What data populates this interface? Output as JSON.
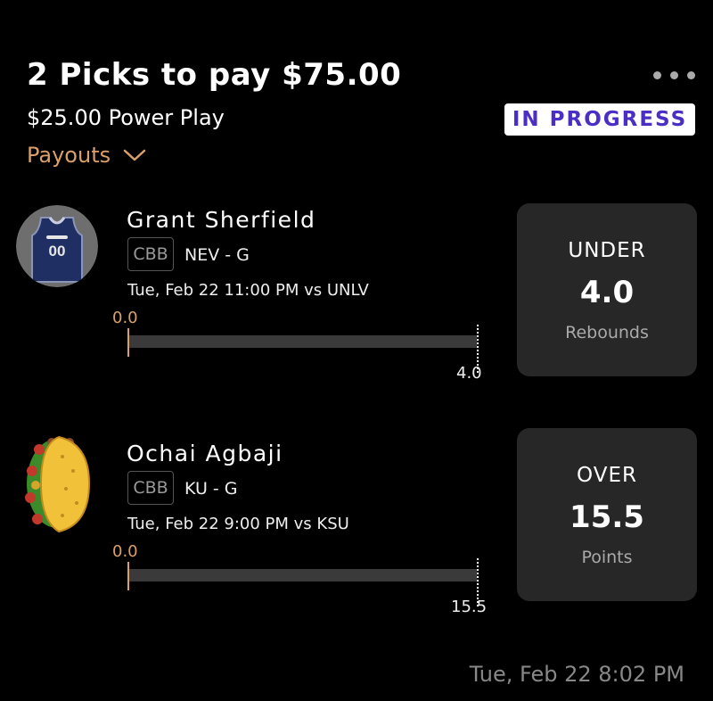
{
  "header": {
    "title": "2 Picks to pay $75.00",
    "subtitle": "$25.00 Power Play",
    "payouts_label": "Payouts",
    "status": "IN PROGRESS",
    "more_icon": "ellipsis-icon"
  },
  "picks": [
    {
      "player": "Grant Sherfield",
      "league": "CBB",
      "team_pos": "NEV - G",
      "game": "Tue, Feb 22 11:00 PM vs UNLV",
      "current": "0.0",
      "target": "4.0",
      "progress": 0,
      "direction": "UNDER",
      "line": "4.0",
      "stat": "Rebounds",
      "avatar": "jersey-icon",
      "jersey_number": "00"
    },
    {
      "player": "Ochai Agbaji",
      "league": "CBB",
      "team_pos": "KU - G",
      "game": "Tue, Feb 22 9:00 PM vs KSU",
      "current": "0.0",
      "target": "15.5",
      "progress": 0,
      "direction": "OVER",
      "line": "15.5",
      "stat": "Points",
      "avatar": "taco-icon"
    }
  ],
  "footer": {
    "timestamp": "Tue, Feb 22 8:02 PM"
  },
  "colors": {
    "background": "#000000",
    "accent_orange": "#d9a06a",
    "status_text": "#4b2fc4",
    "card_bg": "#272727"
  }
}
